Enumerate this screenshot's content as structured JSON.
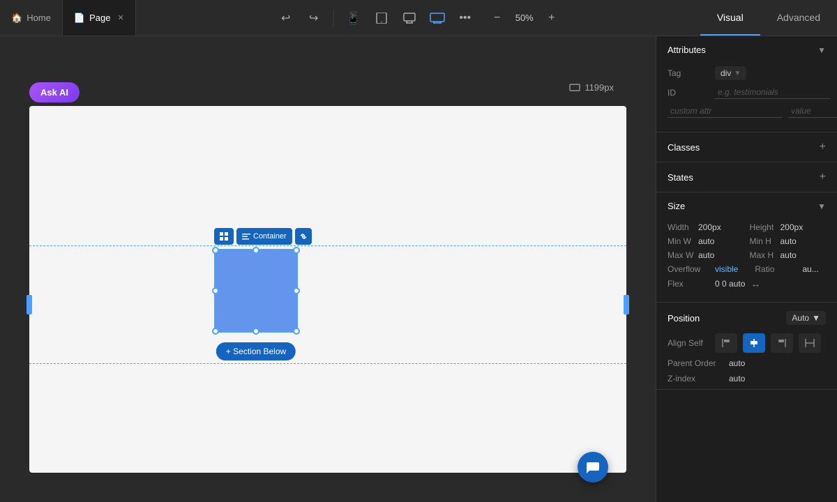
{
  "topbar": {
    "home_tab": "Home",
    "page_tab": "Page",
    "zoom_level": "50%",
    "undo_icon": "↩",
    "redo_icon": "↪",
    "more_icon": "•••",
    "zoom_minus": "−",
    "zoom_plus": "+",
    "visual_tab": "Visual",
    "advanced_tab": "Advanced",
    "device_icons": [
      "mobile",
      "tablet",
      "desktop",
      "widescreen"
    ]
  },
  "canvas": {
    "ask_ai_label": "Ask AI",
    "px_display": "1199px",
    "section_below_label": "+ Section Below"
  },
  "panel": {
    "attributes": {
      "title": "Attributes",
      "tag_label": "Tag",
      "tag_value": "div",
      "id_label": "ID",
      "id_placeholder": "e.g. testimonials",
      "custom_attr_placeholder": "custom attr",
      "value_placeholder": "value"
    },
    "classes": {
      "title": "Classes"
    },
    "states": {
      "title": "States"
    },
    "size": {
      "title": "Size",
      "width_label": "Width",
      "width_value": "200px",
      "height_label": "Height",
      "height_value": "200px",
      "min_w_label": "Min W",
      "min_w_value": "auto",
      "min_h_label": "Min H",
      "min_h_value": "auto",
      "max_w_label": "Max W",
      "max_w_value": "auto",
      "max_h_label": "Max H",
      "max_h_value": "auto",
      "overflow_label": "Overflow",
      "overflow_value": "visible",
      "ratio_label": "Ratio",
      "ratio_value": "au...",
      "flex_label": "Flex",
      "flex_value": "0 0 auto"
    },
    "position": {
      "title": "Position",
      "position_value": "Auto",
      "align_self_label": "Align Self",
      "parent_order_label": "Parent Order",
      "parent_order_value": "auto",
      "zindex_label": "Z-index",
      "zindex_value": "auto"
    }
  },
  "container": {
    "label": "Container"
  }
}
